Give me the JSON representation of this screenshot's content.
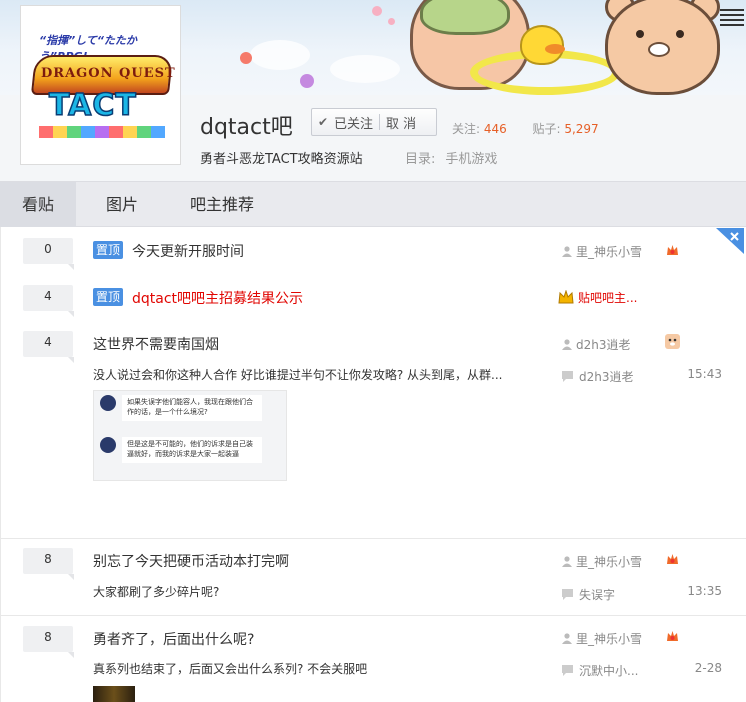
{
  "forum": {
    "logo": {
      "tagline": "“指揮”して“たたかう”RPG!",
      "title_text": "DRAGON QUEST",
      "sub_text": "TACT"
    },
    "name": "dqtact吧",
    "follow_label": "已关注",
    "cancel_label": "取 消",
    "followers_label": "关注:",
    "followers_value": "446",
    "posts_label": "贴子:",
    "posts_value": "5,297",
    "description": "勇者斗恶龙TACT攻略资源站",
    "category_label": "目录:",
    "category_value": "手机游戏"
  },
  "tabs": [
    "看贴",
    "图片",
    "吧主推荐"
  ],
  "threads": [
    {
      "replies": "0",
      "pinned_label": "置顶",
      "title": "今天更新开服时间",
      "author": "里_神乐小雪"
    },
    {
      "replies": "4",
      "pinned_label": "置顶",
      "title": "dqtact吧吧主招募结果公示",
      "author": "贴吧吧主..."
    },
    {
      "replies": "4",
      "title": "这世界不需要南国烟",
      "author": "d2h3逍老",
      "abstract": "没人说过会和你这种人合作 好比谁提过半句不让你发攻略? 从头到尾，从群...",
      "last_reply_user": "d2h3逍老",
      "last_reply_time": "15:43",
      "image": {
        "msg1": "如果失误字他们能容人，我现在跟他们合作的话，是一个什么境况?",
        "msg2": "但是这是不可能的，他们的诉求是自己装逼就好，而我的诉求是大家一起装逼"
      }
    },
    {
      "replies": "8",
      "title": "别忘了今天把硬币活动本打完啊",
      "author": "里_神乐小雪",
      "abstract": "大家都刷了多少碎片呢?",
      "last_reply_user": "失误字",
      "last_reply_time": "13:35"
    },
    {
      "replies": "8",
      "title": "勇者齐了，后面出什么呢?",
      "author": "里_神乐小雪",
      "abstract": "真系列也结束了，后面又会出什么系列? 不会关服吧",
      "last_reply_user": "沉默中小...",
      "last_reply_time": "2-28"
    }
  ],
  "colors": {
    "accent_orange": "#e66028",
    "pin_blue": "#4a90e2",
    "title_red": "#e10602",
    "tab_bg": "#e9eaee"
  },
  "icons": [
    "menu-icon",
    "close-icon",
    "user-icon",
    "reply-icon",
    "check-icon",
    "level-badge-icon",
    "crown-icon"
  ]
}
